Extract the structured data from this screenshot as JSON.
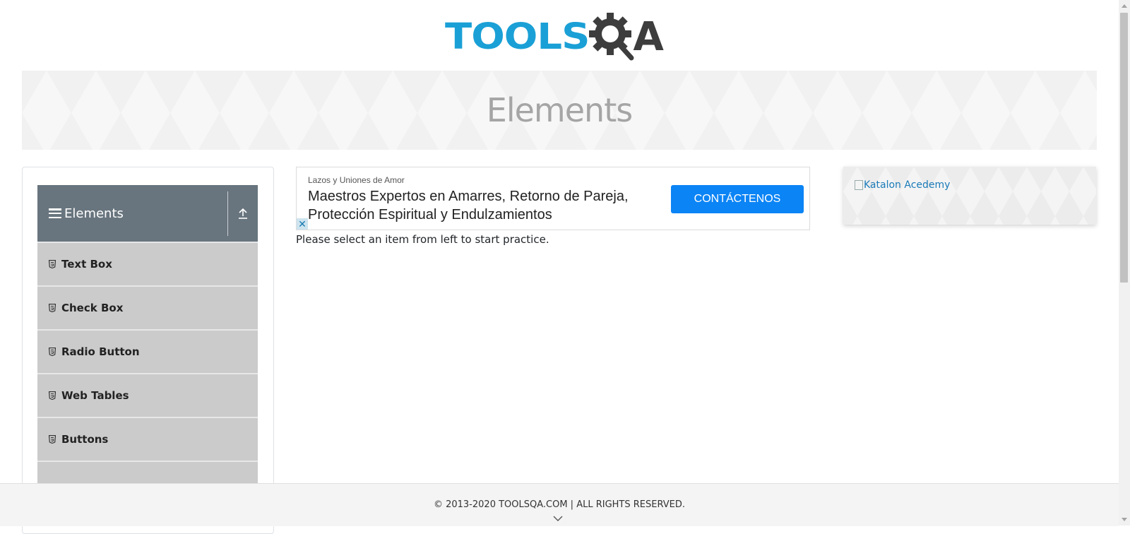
{
  "header": {
    "logo_text_left": "TOOLS",
    "logo_text_right": "A",
    "page_title": "Elements"
  },
  "sidebar": {
    "group_title": "Elements",
    "items": [
      {
        "label": "Text Box"
      },
      {
        "label": "Check Box"
      },
      {
        "label": "Radio Button"
      },
      {
        "label": "Web Tables"
      },
      {
        "label": "Buttons"
      },
      {
        "label": ""
      }
    ]
  },
  "ad": {
    "advertiser": "Lazos y Uniones de Amor",
    "headline": "Maestros Expertos en Amarres, Retorno de Pareja, Protección Espiritual y Endulzamientos",
    "cta_label": "CONTÁCTENOS",
    "close_glyph": "✕"
  },
  "main": {
    "instruction": "Please select an item from left to start practice."
  },
  "right_panel": {
    "image_alt": "Katalon Acedemy"
  },
  "footer": {
    "copyright": "© 2013-2020 TOOLSQA.COM | ALL RIGHTS RESERVED."
  },
  "colors": {
    "logo_blue": "#1aa0d6",
    "logo_dark": "#3d3d3d",
    "group_header_bg": "#68757e",
    "menu_item_bg": "#cbcbcb",
    "cta_bg": "#0b84f5"
  }
}
